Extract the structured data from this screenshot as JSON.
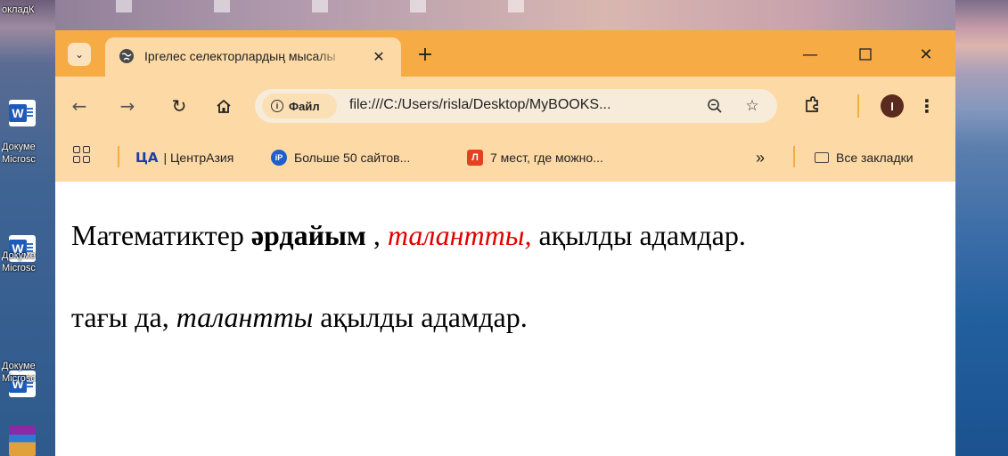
{
  "desktop": {
    "icons": [
      {
        "label": "окладК",
        "icon": "folder-icon"
      },
      {
        "label": "Докуме",
        "sublabel": "Microsc",
        "icon": "word-doc-icon"
      },
      {
        "label": "Докуме",
        "sublabel": "Microsc",
        "icon": "word-doc-icon"
      },
      {
        "label": "Докуме",
        "sublabel": "Microsc",
        "icon": "word-doc-icon"
      },
      {
        "label": "",
        "icon": "winrar-icon"
      }
    ]
  },
  "browser": {
    "tab": {
      "title": "Іргелес селекторлардың мысалы",
      "favicon": "globe-icon"
    },
    "window_controls": {
      "minimize": "—",
      "maximize": "☐",
      "close": "✕"
    },
    "toolbar": {
      "site_chip": "Файл",
      "url": "file:///C:/Users/risla/Desktop/MyBOOKS...",
      "profile_initial": "I"
    },
    "bookmarks": [
      {
        "logo": "ЦА",
        "label": "| ЦентрАзия"
      },
      {
        "logo": "iP",
        "label": "Больше 50 сайтов..."
      },
      {
        "logo": "Л",
        "label": "7 мест, где можно..."
      }
    ],
    "bookmarks_more": "»",
    "all_bookmarks": "Все закладки"
  },
  "content": {
    "line1": {
      "part1": "Математиктер ",
      "bold": "әрдайым",
      "part2": " , ",
      "red_italic": "талантты,",
      "part3": " ақылды адамдар."
    },
    "line2": {
      "part1": "тағы да, ",
      "italic": "талантты",
      "part2": " ақылды адамдар."
    }
  },
  "colors": {
    "titlebar": "#f6ab45",
    "toolbar": "#fdd9a6",
    "red_text": "#e00000"
  }
}
